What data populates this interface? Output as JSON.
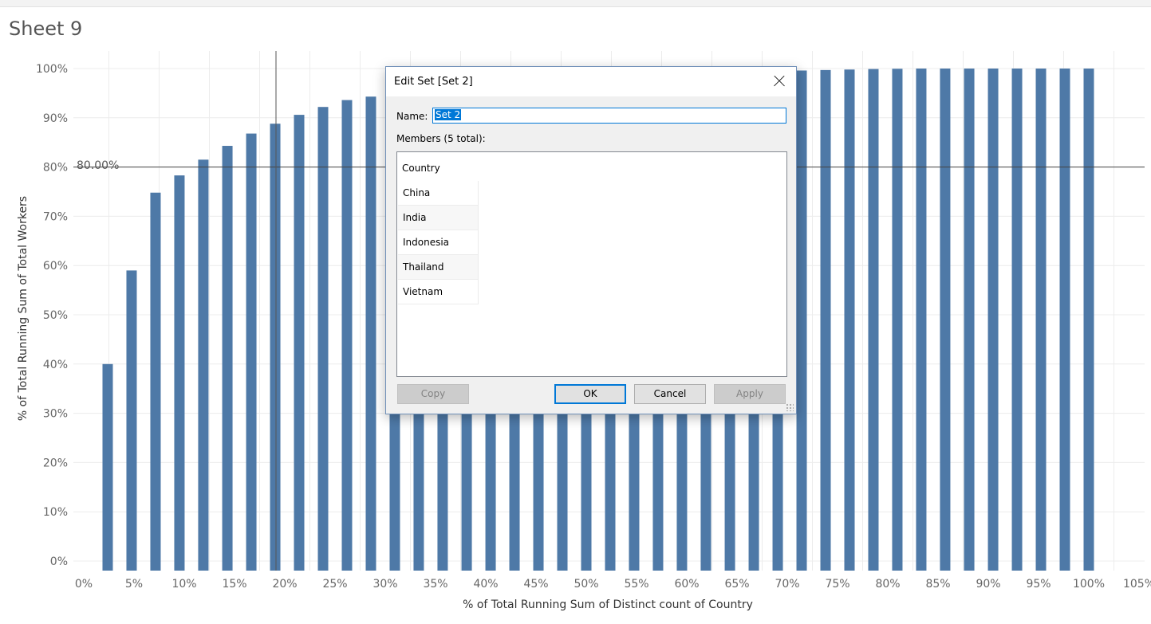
{
  "sheet": {
    "title": "Sheet 9"
  },
  "reference_line": {
    "label": "80.00%",
    "value": 80
  },
  "chart_data": {
    "type": "bar",
    "xlabel": "% of Total Running Sum of Distinct count of Country",
    "ylabel": "% of Total Running Sum of Total Workers",
    "x_ticks": [
      "0%",
      "5%",
      "10%",
      "15%",
      "20%",
      "25%",
      "30%",
      "35%",
      "40%",
      "45%",
      "50%",
      "55%",
      "60%",
      "65%",
      "70%",
      "75%",
      "80%",
      "85%",
      "90%",
      "95%",
      "100%",
      "105%"
    ],
    "y_ticks": [
      "0%",
      "10%",
      "20%",
      "30%",
      "40%",
      "50%",
      "60%",
      "70%",
      "80%",
      "90%",
      "100%"
    ],
    "xlim": [
      0,
      105
    ],
    "ylim": [
      0,
      100
    ],
    "x": [
      2.38,
      4.76,
      7.14,
      9.52,
      11.9,
      14.29,
      16.67,
      19.05,
      21.43,
      23.81,
      26.19,
      28.57,
      30.95,
      33.33,
      35.71,
      38.1,
      40.48,
      42.86,
      45.24,
      47.62,
      50,
      52.38,
      54.76,
      57.14,
      59.52,
      61.9,
      64.29,
      66.67,
      69.05,
      71.43,
      73.81,
      76.19,
      78.57,
      80.95,
      83.33,
      85.71,
      88.1,
      90.48,
      92.86,
      95.24,
      97.62,
      100
    ],
    "values": [
      40,
      59,
      74.8,
      78.3,
      81.5,
      84.3,
      86.8,
      88.8,
      90.6,
      92.2,
      93.6,
      94.3,
      95,
      95.5,
      96,
      96.4,
      96.8,
      97.2,
      97.5,
      97.8,
      98,
      98.2,
      98.4,
      98.6,
      98.8,
      99,
      99.2,
      99.3,
      99.5,
      99.6,
      99.7,
      99.8,
      99.9,
      99.95,
      100,
      100,
      100,
      100,
      100,
      100,
      100,
      100
    ],
    "bar_color": "#4e79a7",
    "grid": true
  },
  "dialog": {
    "title": "Edit Set [Set 2]",
    "name_label": "Name:",
    "name_value": "Set 2",
    "members_label": "Members (5 total):",
    "members_header": "Country",
    "members": [
      "China",
      "India",
      "Indonesia",
      "Thailand",
      "Vietnam"
    ],
    "buttons": {
      "copy": "Copy",
      "ok": "OK",
      "cancel": "Cancel",
      "apply": "Apply"
    }
  },
  "colors": {
    "bar": "#4e79a7",
    "grid": "#ececec",
    "accent": "#0078d7"
  }
}
